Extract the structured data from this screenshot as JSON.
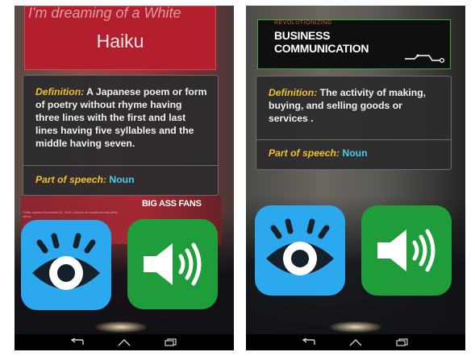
{
  "screens": {
    "left": {
      "background": {
        "cover_top_text": "I'm dreaming of a White",
        "cover_title": "Haiku",
        "print_big_text": "BIG ASS FANS",
        "print_fine_text": "*Offer expires December 31, 2010. Cannot be combined with other offers."
      },
      "card": {
        "definition_label": "Definition:",
        "definition_text": " A Japanese poem or form of poetry without rhyme having three lines with the first and last lines having five syllables and the middle having seven.",
        "pos_label": "Part of speech:",
        "pos_value": " Noun"
      }
    },
    "right": {
      "background": {
        "cover_small_text": "REVOLUTIONIZING",
        "cover_line1": "BUSINESS",
        "cover_line2": "COMMUNICATION"
      },
      "card": {
        "definition_label": "Definition:",
        "definition_text": " The activity of making, buying, and selling goods or services .",
        "pos_label": "Part of speech:",
        "pos_value": " Noun"
      }
    }
  },
  "buttons": {
    "eye": {
      "icon": "eye-icon",
      "color": "#2ca8ee"
    },
    "speak": {
      "icon": "speaker-icon",
      "color": "#1f9d3a"
    }
  },
  "colors": {
    "label_yellow": "#f2bf2f",
    "noun_cyan": "#45cfe6",
    "card_bg": "#2c2c2e"
  },
  "navbar": {
    "icons": [
      "back-icon",
      "home-icon",
      "recent-apps-icon"
    ]
  }
}
